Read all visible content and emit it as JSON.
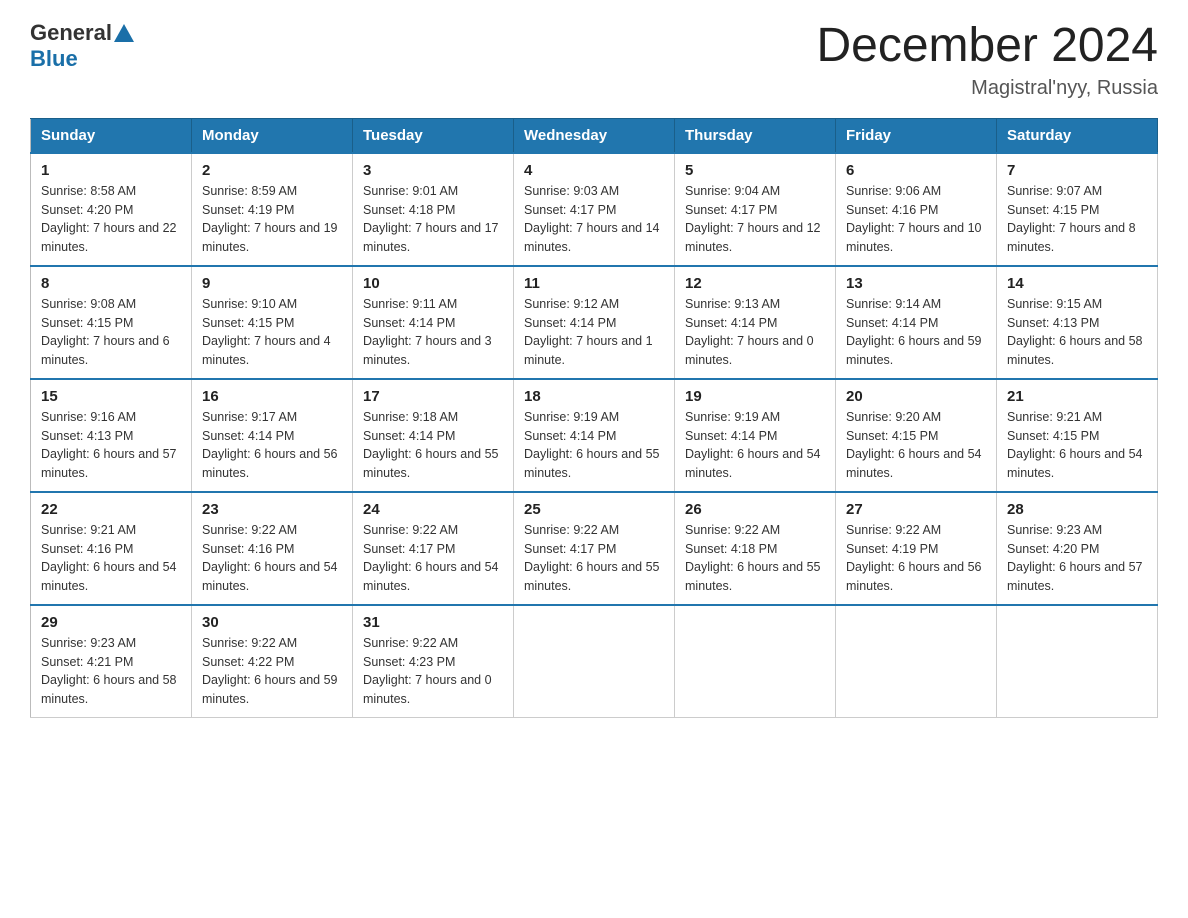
{
  "header": {
    "logo_general": "General",
    "logo_blue": "Blue",
    "month_title": "December 2024",
    "location": "Magistral'nyy, Russia"
  },
  "days_of_week": [
    "Sunday",
    "Monday",
    "Tuesday",
    "Wednesday",
    "Thursday",
    "Friday",
    "Saturday"
  ],
  "weeks": [
    [
      {
        "day": "1",
        "sunrise": "Sunrise: 8:58 AM",
        "sunset": "Sunset: 4:20 PM",
        "daylight": "Daylight: 7 hours and 22 minutes."
      },
      {
        "day": "2",
        "sunrise": "Sunrise: 8:59 AM",
        "sunset": "Sunset: 4:19 PM",
        "daylight": "Daylight: 7 hours and 19 minutes."
      },
      {
        "day": "3",
        "sunrise": "Sunrise: 9:01 AM",
        "sunset": "Sunset: 4:18 PM",
        "daylight": "Daylight: 7 hours and 17 minutes."
      },
      {
        "day": "4",
        "sunrise": "Sunrise: 9:03 AM",
        "sunset": "Sunset: 4:17 PM",
        "daylight": "Daylight: 7 hours and 14 minutes."
      },
      {
        "day": "5",
        "sunrise": "Sunrise: 9:04 AM",
        "sunset": "Sunset: 4:17 PM",
        "daylight": "Daylight: 7 hours and 12 minutes."
      },
      {
        "day": "6",
        "sunrise": "Sunrise: 9:06 AM",
        "sunset": "Sunset: 4:16 PM",
        "daylight": "Daylight: 7 hours and 10 minutes."
      },
      {
        "day": "7",
        "sunrise": "Sunrise: 9:07 AM",
        "sunset": "Sunset: 4:15 PM",
        "daylight": "Daylight: 7 hours and 8 minutes."
      }
    ],
    [
      {
        "day": "8",
        "sunrise": "Sunrise: 9:08 AM",
        "sunset": "Sunset: 4:15 PM",
        "daylight": "Daylight: 7 hours and 6 minutes."
      },
      {
        "day": "9",
        "sunrise": "Sunrise: 9:10 AM",
        "sunset": "Sunset: 4:15 PM",
        "daylight": "Daylight: 7 hours and 4 minutes."
      },
      {
        "day": "10",
        "sunrise": "Sunrise: 9:11 AM",
        "sunset": "Sunset: 4:14 PM",
        "daylight": "Daylight: 7 hours and 3 minutes."
      },
      {
        "day": "11",
        "sunrise": "Sunrise: 9:12 AM",
        "sunset": "Sunset: 4:14 PM",
        "daylight": "Daylight: 7 hours and 1 minute."
      },
      {
        "day": "12",
        "sunrise": "Sunrise: 9:13 AM",
        "sunset": "Sunset: 4:14 PM",
        "daylight": "Daylight: 7 hours and 0 minutes."
      },
      {
        "day": "13",
        "sunrise": "Sunrise: 9:14 AM",
        "sunset": "Sunset: 4:14 PM",
        "daylight": "Daylight: 6 hours and 59 minutes."
      },
      {
        "day": "14",
        "sunrise": "Sunrise: 9:15 AM",
        "sunset": "Sunset: 4:13 PM",
        "daylight": "Daylight: 6 hours and 58 minutes."
      }
    ],
    [
      {
        "day": "15",
        "sunrise": "Sunrise: 9:16 AM",
        "sunset": "Sunset: 4:13 PM",
        "daylight": "Daylight: 6 hours and 57 minutes."
      },
      {
        "day": "16",
        "sunrise": "Sunrise: 9:17 AM",
        "sunset": "Sunset: 4:14 PM",
        "daylight": "Daylight: 6 hours and 56 minutes."
      },
      {
        "day": "17",
        "sunrise": "Sunrise: 9:18 AM",
        "sunset": "Sunset: 4:14 PM",
        "daylight": "Daylight: 6 hours and 55 minutes."
      },
      {
        "day": "18",
        "sunrise": "Sunrise: 9:19 AM",
        "sunset": "Sunset: 4:14 PM",
        "daylight": "Daylight: 6 hours and 55 minutes."
      },
      {
        "day": "19",
        "sunrise": "Sunrise: 9:19 AM",
        "sunset": "Sunset: 4:14 PM",
        "daylight": "Daylight: 6 hours and 54 minutes."
      },
      {
        "day": "20",
        "sunrise": "Sunrise: 9:20 AM",
        "sunset": "Sunset: 4:15 PM",
        "daylight": "Daylight: 6 hours and 54 minutes."
      },
      {
        "day": "21",
        "sunrise": "Sunrise: 9:21 AM",
        "sunset": "Sunset: 4:15 PM",
        "daylight": "Daylight: 6 hours and 54 minutes."
      }
    ],
    [
      {
        "day": "22",
        "sunrise": "Sunrise: 9:21 AM",
        "sunset": "Sunset: 4:16 PM",
        "daylight": "Daylight: 6 hours and 54 minutes."
      },
      {
        "day": "23",
        "sunrise": "Sunrise: 9:22 AM",
        "sunset": "Sunset: 4:16 PM",
        "daylight": "Daylight: 6 hours and 54 minutes."
      },
      {
        "day": "24",
        "sunrise": "Sunrise: 9:22 AM",
        "sunset": "Sunset: 4:17 PM",
        "daylight": "Daylight: 6 hours and 54 minutes."
      },
      {
        "day": "25",
        "sunrise": "Sunrise: 9:22 AM",
        "sunset": "Sunset: 4:17 PM",
        "daylight": "Daylight: 6 hours and 55 minutes."
      },
      {
        "day": "26",
        "sunrise": "Sunrise: 9:22 AM",
        "sunset": "Sunset: 4:18 PM",
        "daylight": "Daylight: 6 hours and 55 minutes."
      },
      {
        "day": "27",
        "sunrise": "Sunrise: 9:22 AM",
        "sunset": "Sunset: 4:19 PM",
        "daylight": "Daylight: 6 hours and 56 minutes."
      },
      {
        "day": "28",
        "sunrise": "Sunrise: 9:23 AM",
        "sunset": "Sunset: 4:20 PM",
        "daylight": "Daylight: 6 hours and 57 minutes."
      }
    ],
    [
      {
        "day": "29",
        "sunrise": "Sunrise: 9:23 AM",
        "sunset": "Sunset: 4:21 PM",
        "daylight": "Daylight: 6 hours and 58 minutes."
      },
      {
        "day": "30",
        "sunrise": "Sunrise: 9:22 AM",
        "sunset": "Sunset: 4:22 PM",
        "daylight": "Daylight: 6 hours and 59 minutes."
      },
      {
        "day": "31",
        "sunrise": "Sunrise: 9:22 AM",
        "sunset": "Sunset: 4:23 PM",
        "daylight": "Daylight: 7 hours and 0 minutes."
      },
      null,
      null,
      null,
      null
    ]
  ]
}
